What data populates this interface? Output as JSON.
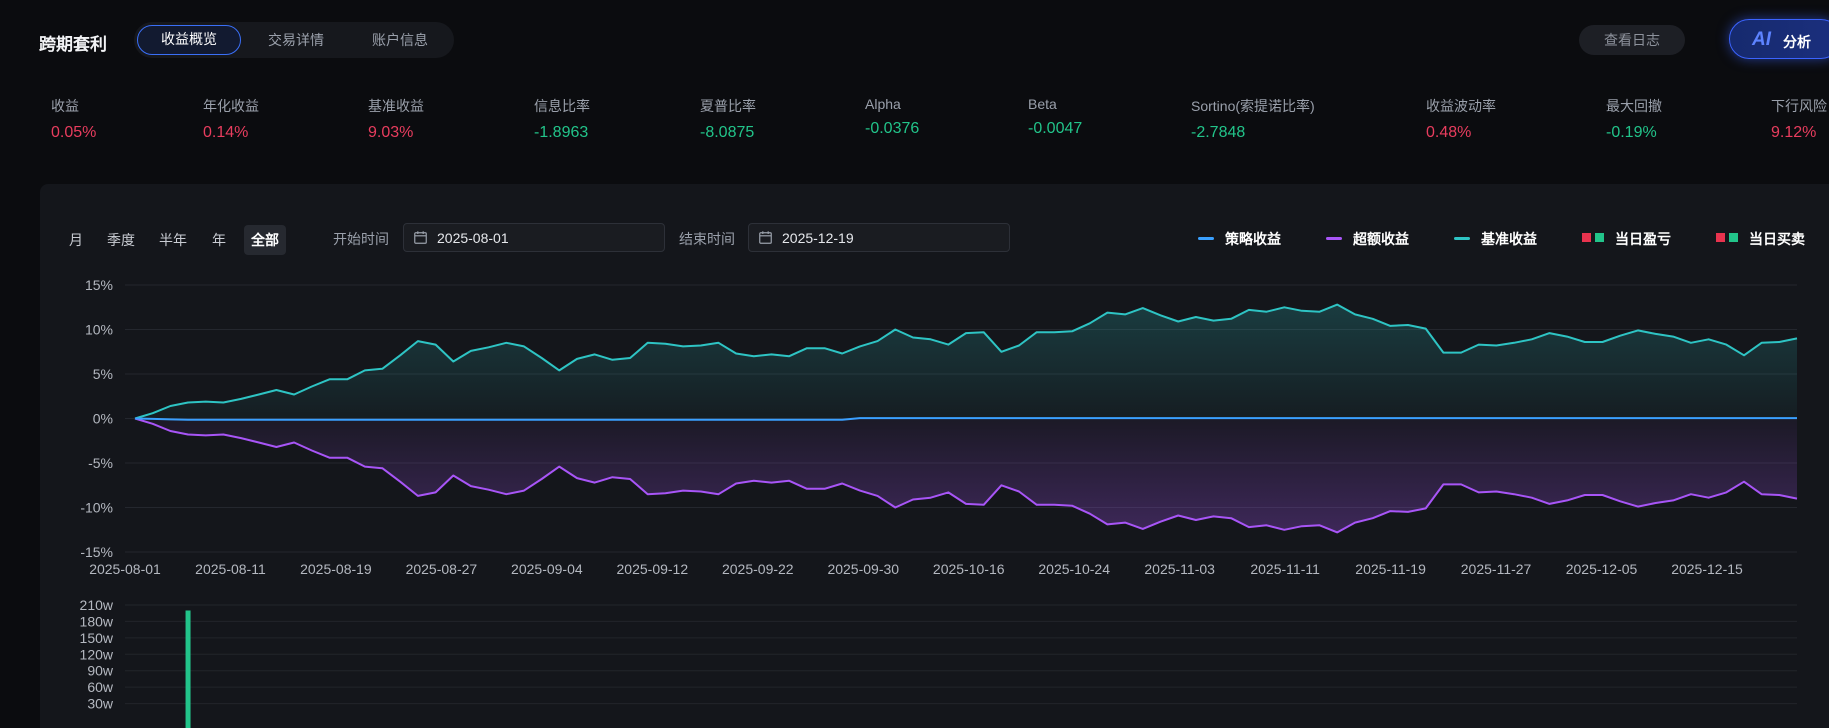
{
  "header": {
    "title": "跨期套利",
    "tabs": [
      "收益概览",
      "交易详情",
      "账户信息"
    ],
    "active_tab": 0,
    "log_button": "查看日志",
    "ai_mark": "AI",
    "ai_label": "分析"
  },
  "metrics": [
    {
      "label": "收益",
      "value": "0.05%",
      "color": "#e83d5e"
    },
    {
      "label": "年化收益",
      "value": "0.14%",
      "color": "#e83d5e"
    },
    {
      "label": "基准收益",
      "value": "9.03%",
      "color": "#e83d5e"
    },
    {
      "label": "信息比率",
      "value": "-1.8963",
      "color": "#22c48a"
    },
    {
      "label": "夏普比率",
      "value": "-8.0875",
      "color": "#22c48a"
    },
    {
      "label": "Alpha",
      "value": "-0.0376",
      "color": "#22c48a"
    },
    {
      "label": "Beta",
      "value": "-0.0047",
      "color": "#22c48a"
    },
    {
      "label": "Sortino(索提诺比率)",
      "value": "-2.7848",
      "color": "#22c48a"
    },
    {
      "label": "收益波动率",
      "value": "0.48%",
      "color": "#e83d5e"
    },
    {
      "label": "最大回撤",
      "value": "-0.19%",
      "color": "#22c48a"
    },
    {
      "label": "下行风险",
      "value": "9.12%",
      "color": "#e83d5e"
    }
  ],
  "controls": {
    "periods": [
      "月",
      "季度",
      "半年",
      "年",
      "全部"
    ],
    "active_period": 4,
    "start_label": "开始时间",
    "start_date": "2025-08-01",
    "end_label": "结束时间",
    "end_date": "2025-12-19"
  },
  "legend": [
    {
      "label": "策略收益",
      "type": "line",
      "color": "#3aa0ff"
    },
    {
      "label": "超额收益",
      "type": "line",
      "color": "#a855f7"
    },
    {
      "label": "基准收益",
      "type": "line",
      "color": "#2ec4c4"
    },
    {
      "label": "当日盈亏",
      "type": "squares",
      "colors": [
        "#e8334e",
        "#22c48a"
      ]
    },
    {
      "label": "当日买卖",
      "type": "squares",
      "colors": [
        "#e8334e",
        "#22c48a"
      ]
    }
  ],
  "chart_data": [
    {
      "type": "line",
      "y_tick_labels": [
        "15%",
        "10%",
        "5%",
        "0%",
        "-5%",
        "-10%",
        "-15%"
      ],
      "ylim": [
        -15,
        15
      ],
      "x_tick_labels": [
        "2025-08-01",
        "2025-08-11",
        "2025-08-19",
        "2025-08-27",
        "2025-09-04",
        "2025-09-12",
        "2025-09-22",
        "2025-09-30",
        "2025-10-16",
        "2025-10-24",
        "2025-11-03",
        "2025-11-11",
        "2025-11-19",
        "2025-11-27",
        "2025-12-05",
        "2025-12-15"
      ],
      "grid": true,
      "series": [
        {
          "name": "基准收益",
          "color": "#2ec4c4",
          "values": [
            0,
            0.6,
            1.4,
            1.8,
            1.9,
            1.8,
            2.2,
            2.7,
            3.2,
            2.7,
            3.6,
            4.4,
            4.4,
            5.4,
            5.6,
            7.1,
            8.7,
            8.3,
            6.4,
            7.6,
            8.0,
            8.5,
            8.1,
            6.8,
            5.4,
            6.7,
            7.2,
            6.6,
            6.8,
            8.5,
            8.4,
            8.1,
            8.2,
            8.5,
            7.3,
            7.0,
            7.2,
            7.0,
            7.9,
            7.9,
            7.3,
            8.1,
            8.7,
            10.0,
            9.1,
            8.9,
            8.3,
            9.6,
            9.7,
            7.5,
            8.2,
            9.7,
            9.7,
            9.8,
            10.7,
            11.9,
            11.7,
            12.4,
            11.6,
            10.9,
            11.4,
            11.0,
            11.2,
            12.2,
            12.0,
            12.5,
            12.1,
            12.0,
            12.8,
            11.7,
            11.2,
            10.4,
            10.5,
            10.1,
            7.4,
            7.4,
            8.3,
            8.2,
            8.5,
            8.9,
            9.6,
            9.2,
            8.6,
            8.6,
            9.3,
            9.9,
            9.5,
            9.2,
            8.5,
            8.9,
            8.3,
            7.1,
            8.5,
            8.6,
            9.0
          ]
        },
        {
          "name": "超额收益",
          "color": "#a855f7",
          "values": [
            0,
            -0.6,
            -1.4,
            -1.8,
            -1.9,
            -1.8,
            -2.2,
            -2.7,
            -3.2,
            -2.7,
            -3.6,
            -4.4,
            -4.4,
            -5.4,
            -5.6,
            -7.1,
            -8.7,
            -8.3,
            -6.4,
            -7.6,
            -8.0,
            -8.5,
            -8.1,
            -6.8,
            -5.4,
            -6.7,
            -7.2,
            -6.6,
            -6.8,
            -8.5,
            -8.4,
            -8.1,
            -8.2,
            -8.5,
            -7.3,
            -7.0,
            -7.2,
            -7.0,
            -7.9,
            -7.9,
            -7.3,
            -8.1,
            -8.7,
            -10.0,
            -9.1,
            -8.9,
            -8.3,
            -9.6,
            -9.7,
            -7.5,
            -8.2,
            -9.7,
            -9.7,
            -9.8,
            -10.7,
            -11.9,
            -11.7,
            -12.4,
            -11.6,
            -10.9,
            -11.4,
            -11.0,
            -11.2,
            -12.2,
            -12.0,
            -12.5,
            -12.1,
            -12.0,
            -12.8,
            -11.7,
            -11.2,
            -10.4,
            -10.5,
            -10.1,
            -7.4,
            -7.4,
            -8.3,
            -8.2,
            -8.5,
            -8.9,
            -9.6,
            -9.2,
            -8.6,
            -8.6,
            -9.3,
            -9.9,
            -9.5,
            -9.2,
            -8.5,
            -8.9,
            -8.3,
            -7.1,
            -8.5,
            -8.6,
            -9.0
          ]
        },
        {
          "name": "策略收益",
          "color": "#3aa0ff",
          "values": [
            0,
            -0.05,
            -0.1,
            -0.15,
            -0.15,
            -0.15,
            -0.15,
            -0.15,
            -0.15,
            -0.15,
            -0.15,
            -0.15,
            -0.15,
            -0.15,
            -0.15,
            -0.15,
            -0.15,
            -0.15,
            -0.15,
            -0.15,
            -0.15,
            -0.15,
            -0.15,
            -0.15,
            -0.15,
            -0.15,
            -0.15,
            -0.15,
            -0.15,
            -0.15,
            -0.15,
            -0.15,
            -0.15,
            -0.15,
            -0.15,
            -0.15,
            -0.15,
            -0.15,
            -0.15,
            -0.15,
            -0.15,
            0.05,
            0.05,
            0.05,
            0.05,
            0.05,
            0.05,
            0.05,
            0.05,
            0.05,
            0.05,
            0.05,
            0.05,
            0.05,
            0.05,
            0.05,
            0.05,
            0.05,
            0.05,
            0.05,
            0.05,
            0.05,
            0.05,
            0.05,
            0.05,
            0.05,
            0.05,
            0.05,
            0.05,
            0.05,
            0.05,
            0.05,
            0.05,
            0.05,
            0.05,
            0.05,
            0.05,
            0.05,
            0.05,
            0.05,
            0.05,
            0.05,
            0.05,
            0.05,
            0.05,
            0.05,
            0.05,
            0.05,
            0.05,
            0.05,
            0.05,
            0.05,
            0.05,
            0.05,
            0.05
          ]
        }
      ]
    },
    {
      "type": "bar",
      "y_tick_labels": [
        "210w",
        "180w",
        "150w",
        "120w",
        "90w",
        "60w",
        "30w"
      ],
      "ylim": [
        0,
        210
      ],
      "grid": true,
      "series": [
        {
          "color": "#22c48a",
          "points": [
            {
              "x_index": 3,
              "value": 200
            }
          ]
        }
      ]
    }
  ]
}
